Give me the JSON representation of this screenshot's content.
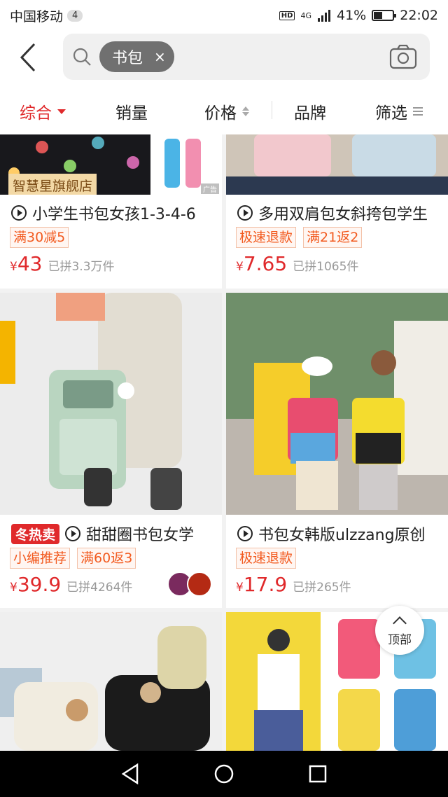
{
  "status_bar": {
    "carrier": "中国移动",
    "notification_count": "4",
    "hd": "HD",
    "network": "4G",
    "battery": "41%",
    "battery_level": 0.41,
    "time": "22:02"
  },
  "search": {
    "chip_text": "书包",
    "chip_close": "×",
    "icons": [
      "back-arrow-icon",
      "search-icon",
      "camera-icon"
    ]
  },
  "sort_bar": {
    "items": [
      "综合",
      "销量",
      "价格",
      "品牌",
      "筛选"
    ],
    "active": "综合",
    "accent": "#e0292b"
  },
  "products": [
    {
      "title": "小学生书包女孩1-3-4-6",
      "store_badge": "智慧星旗舰店",
      "ad_label": "广告",
      "tags": [
        "满30减5"
      ],
      "currency": "¥",
      "price": "43",
      "sold": "已拼3.3万件"
    },
    {
      "title": "多用双肩包女斜挎包学生",
      "tags": [
        "极速退款",
        "满21返2"
      ],
      "currency": "¥",
      "price": "7.65",
      "sold": "已拼1065件"
    },
    {
      "hot_badge": "冬热卖",
      "title": "甜甜圈书包女学",
      "tags": [
        "小编推荐",
        "满60返3"
      ],
      "currency": "¥",
      "price": "39.9",
      "sold": "已拼4264件"
    },
    {
      "title": "书包女韩版ulzzang原创",
      "tags": [
        "极速退款"
      ],
      "currency": "¥",
      "price": "17.9",
      "sold": "已拼265件"
    }
  ],
  "back_to_top": "顶部",
  "nav_bar": [
    "back-nav-icon",
    "home-nav-icon",
    "recents-nav-icon"
  ]
}
